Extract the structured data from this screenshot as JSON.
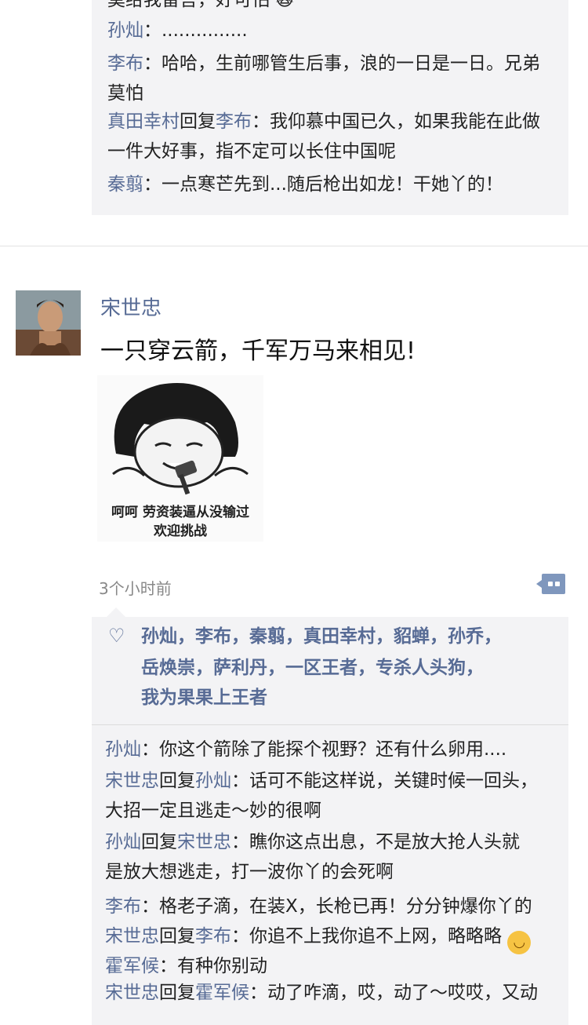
{
  "top_comments": [
    {
      "text": "莫给我留言，好可怕 🙀"
    },
    {
      "name": "孙灿",
      "text": "：..............."
    },
    {
      "name": "李布",
      "text": "：哈哈，生前哪管生后事，浪的一日是一日。兄弟"
    },
    {
      "text": "莫怕"
    },
    {
      "name": "真田幸村",
      "mid": "回复",
      "name2": "李布",
      "text": "：我仰慕中国已久，如果我能在此做"
    },
    {
      "text": "一件大好事，指不定可以长住中国呢"
    },
    {
      "name": "秦翦",
      "text": "：一点寒芒先到...随后枪出如龙！干她丫的！"
    }
  ],
  "post": {
    "author": "宋世忠",
    "text": "一只穿云箭，千军万马来相见!",
    "meme_caption_1": "呵呵 劳资装逼从没输过",
    "meme_caption_2": "欢迎挑战",
    "time": "3个小时前"
  },
  "likes": {
    "line1": [
      "孙灿",
      "李布",
      "秦翦",
      "真田幸村",
      "貂蝉",
      "孙乔"
    ],
    "line2": [
      "岳焕崇",
      "萨利丹",
      "一区王者",
      "专杀人头狗"
    ],
    "line3": [
      "我为果果上王者"
    ],
    "sep": "，"
  },
  "comments": [
    {
      "name": "孙灿",
      "text": "：你这个箭除了能探个视野？还有什么卵用...."
    },
    {
      "name": "宋世忠",
      "mid": "回复",
      "name2": "孙灿",
      "text": "：话可不能这样说，关键时候一回头，"
    },
    {
      "text": "大招一定且逃走～妙的很啊"
    },
    {
      "name": "孙灿",
      "mid": "回复",
      "name2": "宋世忠",
      "text": "：瞧你这点出息，不是放大抢人头就"
    },
    {
      "text": "是放大想逃走，打一波你丫的会死啊"
    },
    {
      "name": "李布",
      "text": "：格老子滴，在装X，长枪已再！分分钟爆你丫的"
    },
    {
      "name": "宋世忠",
      "mid": "回复",
      "name2": "李布",
      "text": "：你追不上我你追不上网，略略略"
    },
    {
      "name": "霍军候",
      "text": "：有种你别动"
    },
    {
      "name": "宋世忠",
      "mid": "回复",
      "name2": "霍军候",
      "text": "：动了咋滴，哎，动了～哎哎，又动"
    }
  ]
}
